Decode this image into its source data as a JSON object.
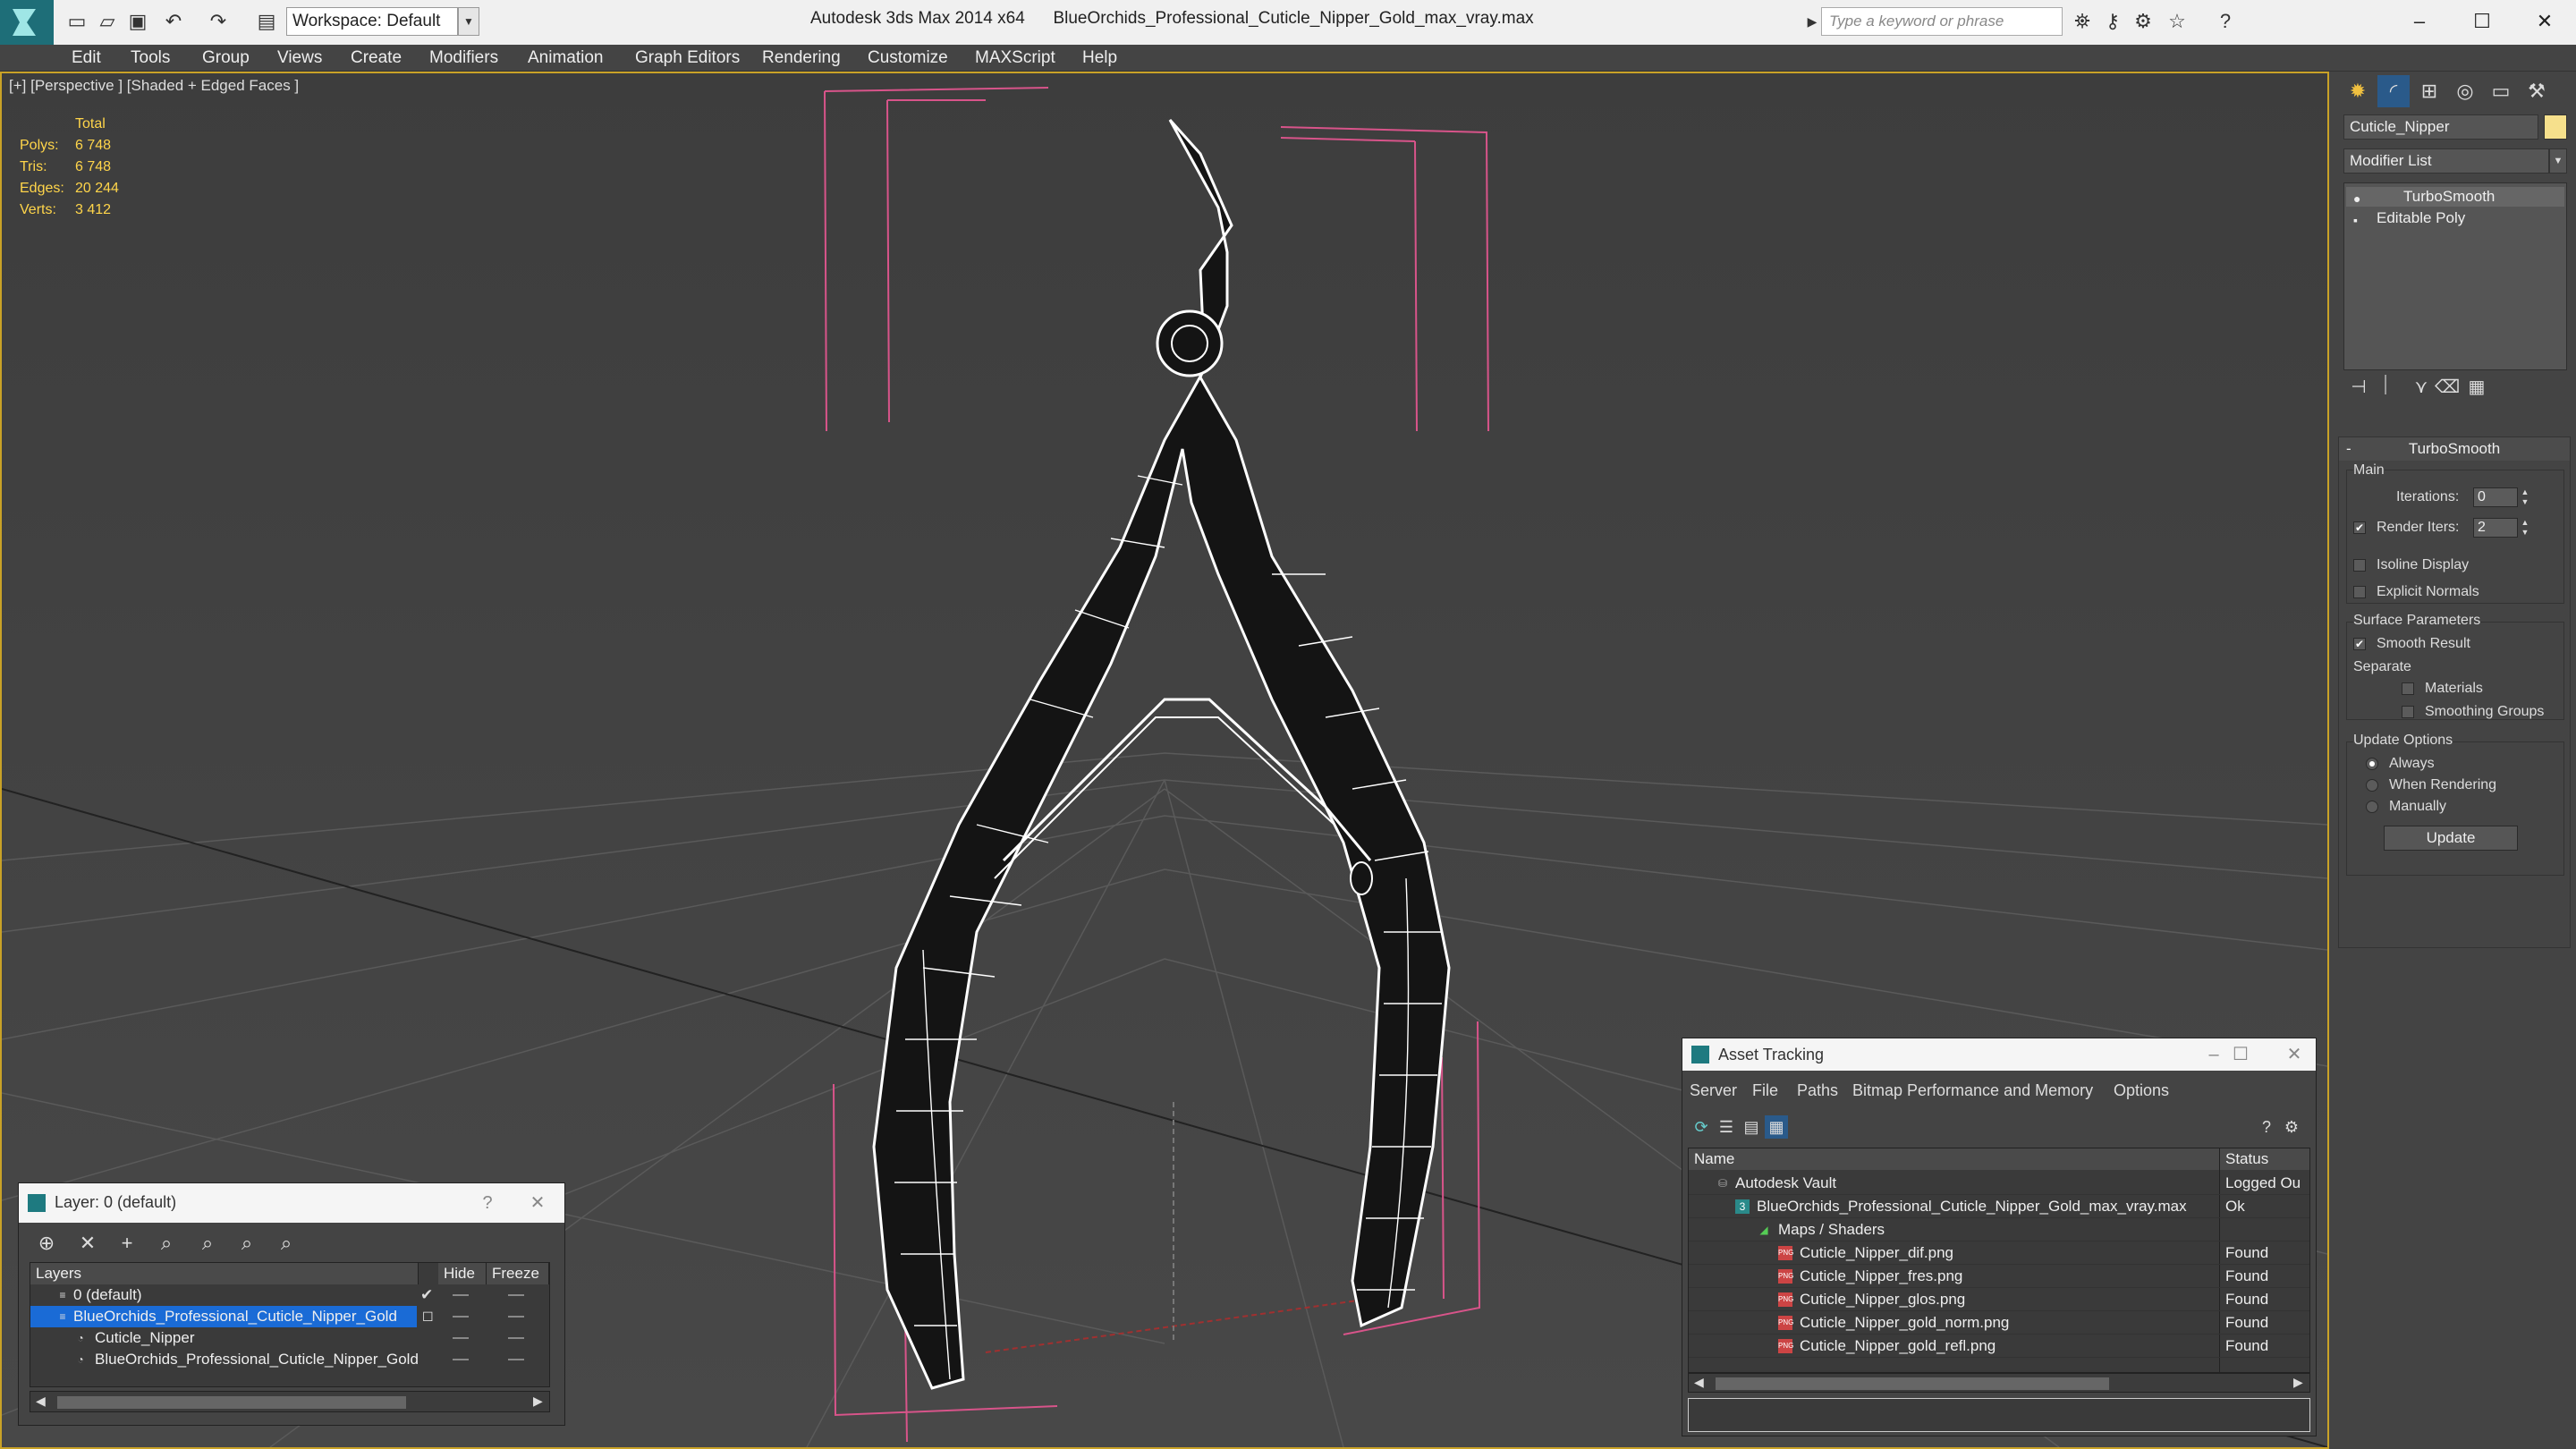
{
  "titlebar": {
    "app": "Autodesk 3ds Max 2014 x64",
    "file": "BlueOrchids_Professional_Cuticle_Nipper_Gold_max_vray.max",
    "workspace": "Workspace: Default",
    "search_placeholder": "Type a keyword or phrase"
  },
  "menu": [
    "Edit",
    "Tools",
    "Group",
    "Views",
    "Create",
    "Modifiers",
    "Animation",
    "Graph Editors",
    "Rendering",
    "Customize",
    "MAXScript",
    "Help"
  ],
  "viewport": {
    "label": "[+] [Perspective ] [Shaded + Edged Faces ]",
    "stats": {
      "header": "Total",
      "rows": [
        {
          "label": "Polys:",
          "value": "6 748"
        },
        {
          "label": "Tris:",
          "value": "6 748"
        },
        {
          "label": "Edges:",
          "value": "20 244"
        },
        {
          "label": "Verts:",
          "value": "3 412"
        }
      ]
    }
  },
  "command_panel": {
    "object_name": "Cuticle_Nipper",
    "object_color": "#f6e08c",
    "modifier_list": "Modifier List",
    "stack": [
      "TurboSmooth",
      "Editable Poly"
    ],
    "turbosmooth": {
      "title": "TurboSmooth",
      "main": "Main",
      "iterations_label": "Iterations:",
      "iterations_value": "0",
      "render_iters_label": "Render Iters:",
      "render_iters_value": "2",
      "render_iters_checked": true,
      "isoline": "Isoline Display",
      "explicit_normals": "Explicit Normals",
      "surface_params": "Surface Parameters",
      "smooth_result": "Smooth Result",
      "smooth_result_checked": true,
      "separate": "Separate",
      "materials": "Materials",
      "smoothing_groups": "Smoothing Groups",
      "update_options": "Update Options",
      "always": "Always",
      "when_rendering": "When Rendering",
      "manually": "Manually",
      "update_button": "Update"
    }
  },
  "asset_tracking": {
    "title": "Asset Tracking",
    "menu": [
      "Server",
      "File",
      "Paths",
      "Bitmap Performance and Memory",
      "Options"
    ],
    "columns": {
      "name": "Name",
      "status": "Status"
    },
    "rows": [
      {
        "name": "Autodesk Vault",
        "status": "Logged Ou"
      },
      {
        "name": "BlueOrchids_Professional_Cuticle_Nipper_Gold_max_vray.max",
        "status": "Ok"
      },
      {
        "name": "Maps / Shaders",
        "status": ""
      },
      {
        "name": "Cuticle_Nipper_dif.png",
        "status": "Found"
      },
      {
        "name": "Cuticle_Nipper_fres.png",
        "status": "Found"
      },
      {
        "name": "Cuticle_Nipper_glos.png",
        "status": "Found"
      },
      {
        "name": "Cuticle_Nipper_gold_norm.png",
        "status": "Found"
      },
      {
        "name": "Cuticle_Nipper_gold_refl.png",
        "status": "Found"
      }
    ]
  },
  "layer_window": {
    "title": "Layer: 0 (default)",
    "columns": {
      "layers": "Layers",
      "hide": "Hide",
      "freeze": "Freeze"
    },
    "rows": [
      {
        "name": "0 (default)"
      },
      {
        "name": "BlueOrchids_Professional_Cuticle_Nipper_Gold"
      },
      {
        "name": "Cuticle_Nipper"
      },
      {
        "name": "BlueOrchids_Professional_Cuticle_Nipper_Gold"
      }
    ]
  }
}
